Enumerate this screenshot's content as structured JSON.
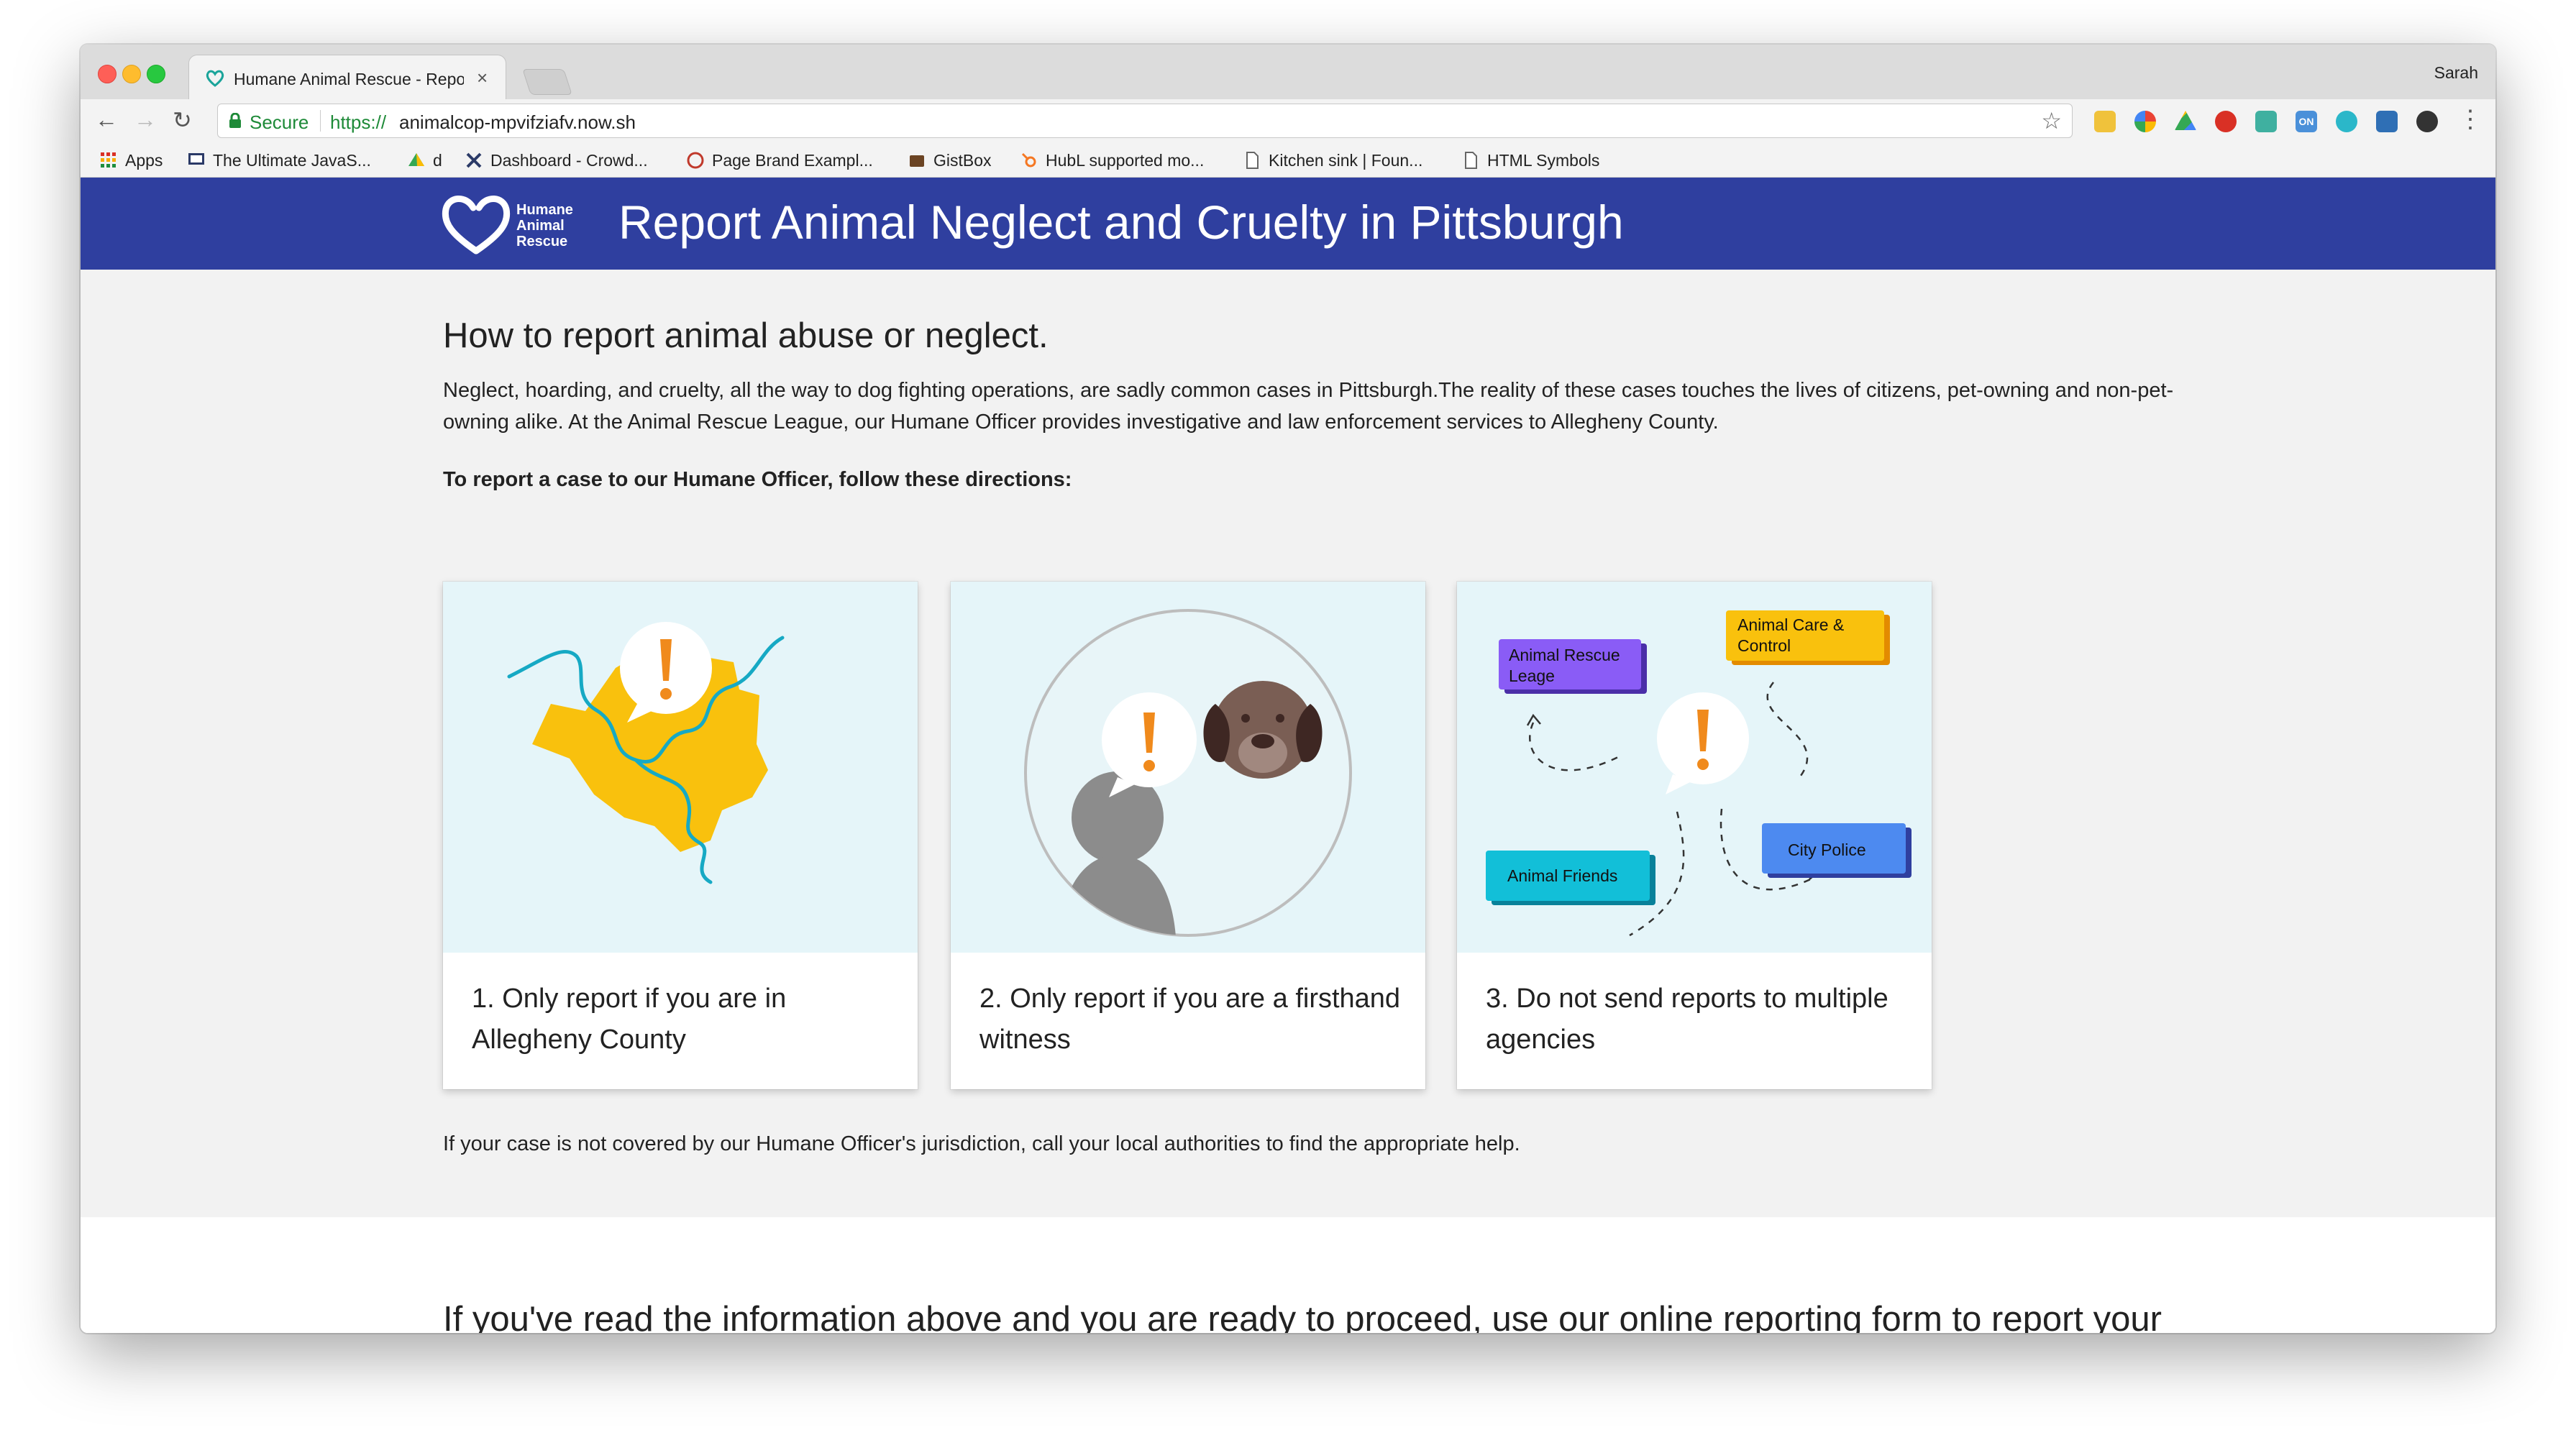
{
  "browser": {
    "tab_title": "Humane Animal Rescue - Report Animal Neglect",
    "tab_close": "×",
    "profile_name": "Sarah",
    "security_label": "Secure",
    "url_scheme": "https://",
    "url_host": "animalcop-mpvifziafv.now.sh",
    "bookmarks": [
      {
        "label": "Apps"
      },
      {
        "label": "The Ultimate JavaS..."
      },
      {
        "label": "d"
      },
      {
        "label": "Dashboard - Crowd..."
      },
      {
        "label": "Page Brand Exampl..."
      },
      {
        "label": "GistBox"
      },
      {
        "label": "HubL supported mo..."
      },
      {
        "label": "Kitchen sink | Foun..."
      },
      {
        "label": "HTML Symbols"
      }
    ],
    "extension_badge": "ON"
  },
  "header": {
    "logo_lines": [
      "Humane",
      "Animal",
      "Rescue"
    ],
    "title": "Report Animal Neglect and Cruelty in Pittsburgh",
    "bar_color": "#2f3f9f"
  },
  "main": {
    "heading": "How to report animal abuse or neglect.",
    "intro": "Neglect, hoarding, and cruelty, all the way to dog fighting operations, are sadly common cases in Pittsburgh.The reality of these cases touches the lives of citizens, pet-owning and non-pet-owning alike. At the Animal Rescue League, our Humane Officer provides investigative and law enforcement services to Allegheny County.",
    "directions": "To report a case to our Humane Officer, follow these directions:",
    "cards": [
      {
        "text": "1. Only report if you are in Allegheny County"
      },
      {
        "text": "2. Only report if you are a firsthand witness"
      },
      {
        "text": "3. Do not send reports to multiple agencies"
      }
    ],
    "agencies": {
      "arl": "Animal Rescue Leage",
      "acc": "Animal Care & Control",
      "friends": "Animal Friends",
      "police": "City Police"
    },
    "footnote": "If your case is not covered by our Humane Officer's jurisdiction, call your local authorities to find the appropriate help.",
    "cta": "If you've read the information above and you are ready to proceed, use our online reporting form to report your incident to our Humane Officer."
  },
  "colors": {
    "accent_orange": "#f08a1c",
    "map_yellow": "#f9c10d",
    "river_teal": "#16a9c4"
  }
}
